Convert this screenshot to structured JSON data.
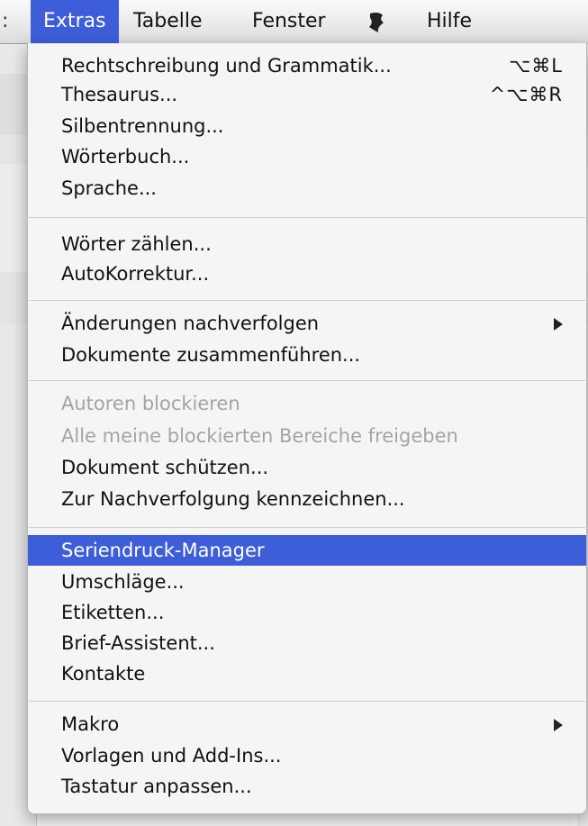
{
  "menubar": {
    "edge": ":",
    "items": [
      "Extras",
      "Tabelle",
      "Fenster",
      "Hilfe"
    ],
    "script_icon": "script-icon"
  },
  "colors": {
    "highlight": "#3d5ed8"
  },
  "menu": {
    "g1": [
      {
        "label": "Rechtschreibung und Grammatik...",
        "shortcut": "⌥⌘L"
      },
      {
        "label": "Thesaurus...",
        "shortcut": "^⌥⌘R"
      },
      {
        "label": "Silbentrennung..."
      },
      {
        "label": "Wörterbuch..."
      },
      {
        "label": "Sprache..."
      }
    ],
    "g2": [
      {
        "label": "Wörter zählen..."
      },
      {
        "label": "AutoKorrektur..."
      }
    ],
    "g3": [
      {
        "label": "Änderungen nachverfolgen"
      },
      {
        "label": "Dokumente zusammenführen..."
      }
    ],
    "g4": [
      {
        "label": "Autoren blockieren"
      },
      {
        "label": "Alle meine blockierten Bereiche freigeben"
      },
      {
        "label": "Dokument schützen..."
      },
      {
        "label": "Zur Nachverfolgung kennzeichnen..."
      }
    ],
    "g5": [
      {
        "label": "Seriendruck-Manager"
      },
      {
        "label": "Umschläge..."
      },
      {
        "label": "Etiketten..."
      },
      {
        "label": "Brief-Assistent..."
      },
      {
        "label": "Kontakte"
      }
    ],
    "g6": [
      {
        "label": "Makro"
      },
      {
        "label": "Vorlagen und Add-Ins..."
      },
      {
        "label": "Tastatur anpassen..."
      }
    ]
  }
}
